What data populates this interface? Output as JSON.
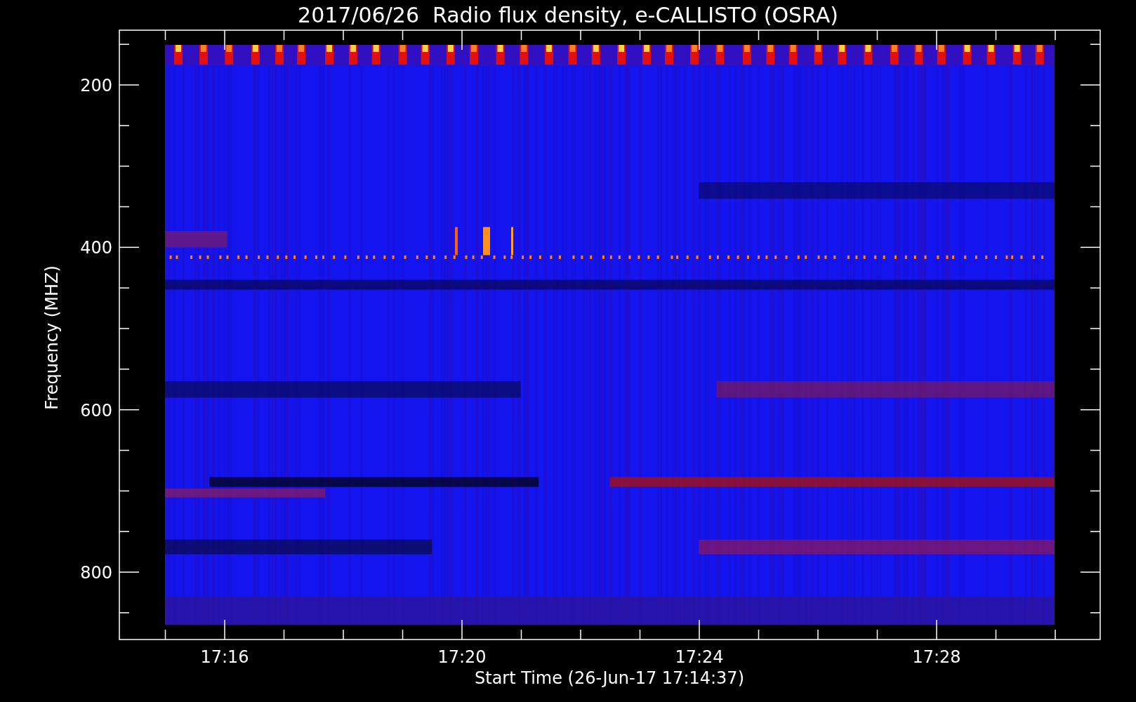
{
  "title": "2017/06/26  Radio flux density, e-CALLISTO (OSRA)",
  "x_axis": {
    "label": "Start Time (26-Jun-17 17:14:37)",
    "tick_labels": [
      "17:16",
      "17:20",
      "17:24",
      "17:28"
    ]
  },
  "y_axis": {
    "label": "Frequency (MHZ)",
    "tick_labels": [
      "200",
      "400",
      "600",
      "800"
    ]
  }
}
